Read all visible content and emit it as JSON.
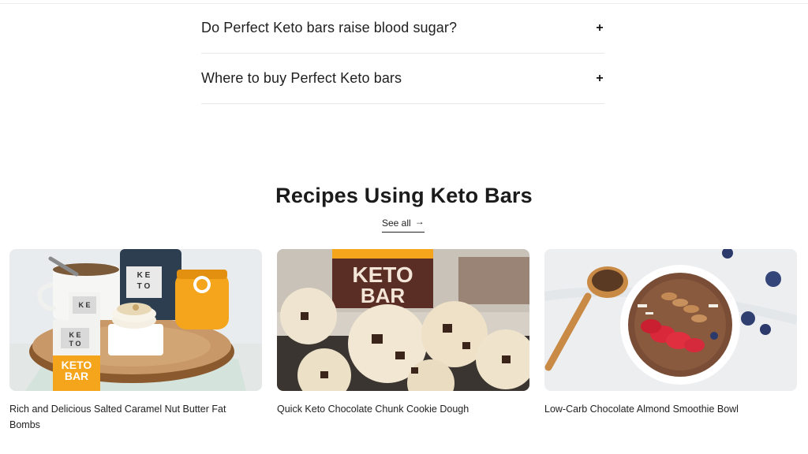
{
  "faq": {
    "items": [
      {
        "question": "Do Perfect Keto bars raise blood sugar?",
        "toggle": "+"
      },
      {
        "question": "Where to buy Perfect Keto bars",
        "toggle": "+"
      }
    ]
  },
  "recipes": {
    "title": "Recipes Using Keto Bars",
    "see_all_label": "See all",
    "see_all_arrow": "→",
    "cards": [
      {
        "title": "Rich and Delicious Salted Caramel Nut Butter Fat Bombs",
        "image_alt": "keto bar products and fat bombs on wooden board"
      },
      {
        "title": "Quick Keto Chocolate Chunk Cookie Dough",
        "image_alt": "cookie dough balls in front of keto bar"
      },
      {
        "title": "Low-Carb Chocolate Almond Smoothie Bowl",
        "image_alt": "chocolate smoothie bowl with strawberries and almonds"
      }
    ]
  },
  "colors": {
    "text": "#1f1f1f",
    "divider": "#e8e8e8",
    "keto_orange": "#f4a51c",
    "keto_brown": "#5a2e24"
  }
}
